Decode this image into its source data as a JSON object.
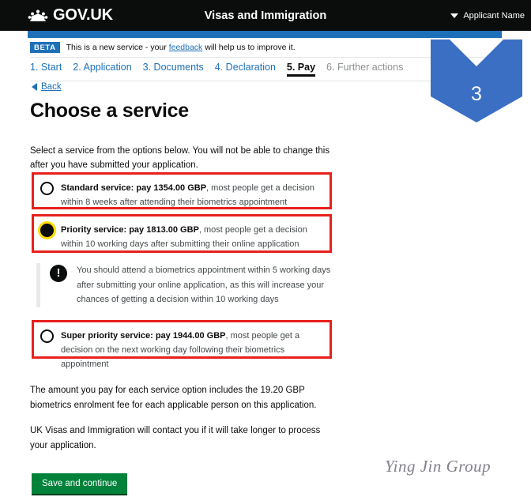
{
  "header": {
    "brand": "GOV.UK",
    "crown_icon": "crown-icon",
    "service_name": "Visas and Immigration",
    "account_caret_icon": "chevron-down-icon",
    "account_name": "Applicant Name"
  },
  "phase_banner": {
    "tag": "BETA",
    "text_before": "This is a new service - your ",
    "link": "feedback",
    "text_after": " will help us to improve it."
  },
  "steps": [
    {
      "label": "1. Start",
      "state": "link"
    },
    {
      "label": "2. Application",
      "state": "link"
    },
    {
      "label": "3. Documents",
      "state": "link"
    },
    {
      "label": "4. Declaration",
      "state": "link"
    },
    {
      "label": "5. Pay",
      "state": "active"
    },
    {
      "label": "6. Further actions",
      "state": "muted"
    }
  ],
  "back": {
    "arrow_icon": "arrow-left-icon",
    "label": "Back"
  },
  "main": {
    "title": "Choose a service",
    "intro": "Select a service from the options below. You will not be able to change this after you have submitted your application.",
    "options": [
      {
        "id": "standard",
        "strong": "Standard service: pay 1354.00 GBP",
        "rest": ", most people get a decision within 8 weeks after attending their biometrics appointment",
        "selected": false
      },
      {
        "id": "priority",
        "strong": "Priority service: pay 1813.00 GBP",
        "rest": ", most people get a decision within 10 working days after submitting their online application",
        "selected": true
      },
      {
        "id": "super",
        "strong": "Super priority service: pay 1944.00 GBP",
        "rest": ", most people get a decision on the next working day following their biometrics appointment",
        "selected": false
      }
    ],
    "callout": {
      "icon": "exclamation-icon",
      "icon_glyph": "!",
      "text": "You should attend a biometrics appointment within 5 working days after submitting your online application, as this will increase your chances of getting a decision within 10 working days"
    },
    "note_fee": "The amount you pay for each service option includes the 19.20 GBP biometrics enrolment fee for each applicable person on this application.",
    "note_contact": "UK Visas and Immigration will contact you if it will take longer to process your application.",
    "submit_label": "Save and continue"
  },
  "annotation": {
    "number": "3",
    "color": "#3a6fc4"
  },
  "watermark": "Ying Jin Group",
  "colors": {
    "header_black": "#0b0c0c",
    "govuk_blue": "#1d70b8",
    "green_button": "#00823b",
    "annotation_red": "#e8201c",
    "focus_yellow": "#ffdd00"
  }
}
